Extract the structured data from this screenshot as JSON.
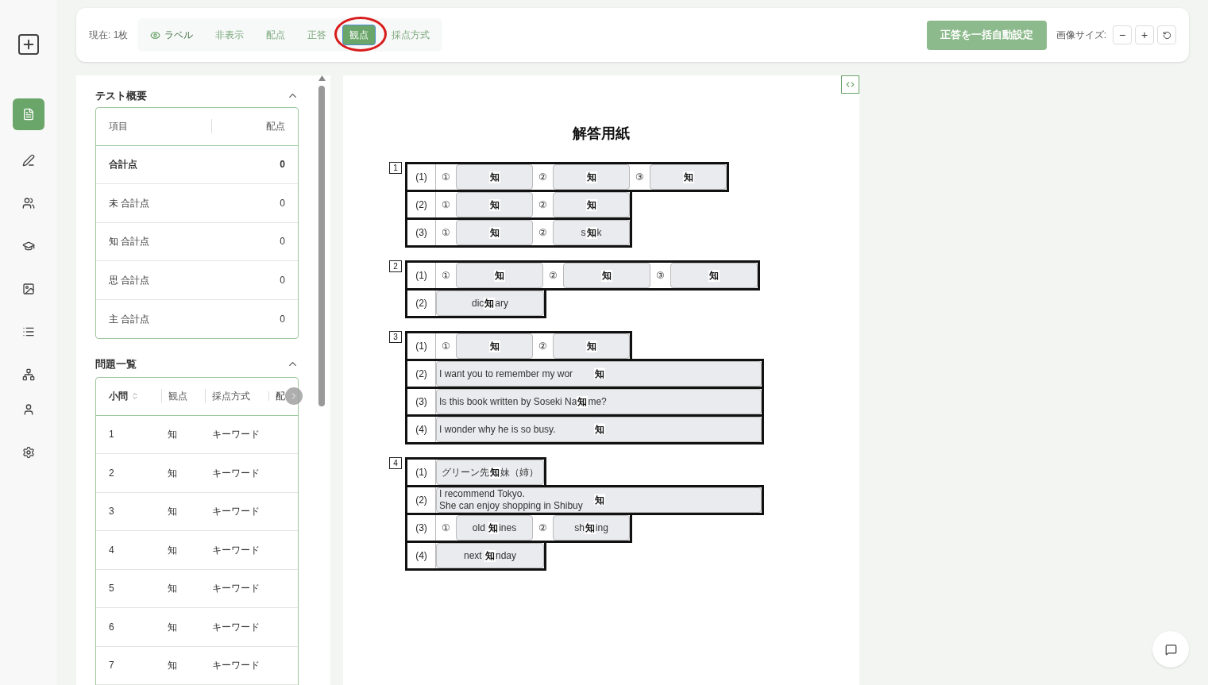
{
  "nav": [
    {
      "selected": false
    },
    {
      "selected": true
    },
    {
      "selected": false
    },
    {
      "selected": false
    },
    {
      "selected": false
    },
    {
      "selected": false
    },
    {
      "selected": false
    },
    {
      "selected": false
    },
    {
      "selected": false
    },
    {
      "selected": false
    }
  ],
  "toolbar": {
    "current": "現在: 1枚",
    "modes": [
      {
        "label": "ラベル",
        "kind": "eye",
        "selected": false
      },
      {
        "label": "非表示",
        "selected": false
      },
      {
        "label": "配点",
        "selected": false
      },
      {
        "label": "正答",
        "selected": false
      },
      {
        "label": "観点",
        "selected": true
      },
      {
        "label": "採点方式",
        "selected": false
      }
    ],
    "auto_button": {
      "label": "正答を一括自動設定",
      "disabled": true
    },
    "image_size_label": "画像サイズ:",
    "size_buttons": [
      {
        "label": "−",
        "kind": "text"
      },
      {
        "label": "+",
        "kind": "text"
      },
      {
        "kind": "reset"
      }
    ]
  },
  "summary": {
    "title": "テスト概要",
    "columns": [
      "項目",
      "配点"
    ],
    "rows": [
      {
        "item": "合計点",
        "score": "0",
        "bold": true
      },
      {
        "item": "未 合計点",
        "score": "0",
        "bold": false
      },
      {
        "item": "知 合計点",
        "score": "0",
        "bold": false
      },
      {
        "item": "思 合計点",
        "score": "0",
        "bold": false
      },
      {
        "item": "主 合計点",
        "score": "0",
        "bold": false
      }
    ]
  },
  "questions": {
    "title": "問題一覧",
    "columns": [
      "小問",
      "観点",
      "採点方式",
      "配"
    ],
    "rows": [
      {
        "no": "1",
        "view": "知",
        "method": "キーワード"
      },
      {
        "no": "2",
        "view": "知",
        "method": "キーワード"
      },
      {
        "no": "3",
        "view": "知",
        "method": "キーワード"
      },
      {
        "no": "4",
        "view": "知",
        "method": "キーワード"
      },
      {
        "no": "5",
        "view": "知",
        "method": "キーワード"
      },
      {
        "no": "6",
        "view": "知",
        "method": "キーワード"
      },
      {
        "no": "7",
        "view": "知",
        "method": "キーワード"
      }
    ]
  },
  "sheet": {
    "title": "解答用紙",
    "sections": [
      {
        "number": "1",
        "rows": [
          {
            "label": "(1)",
            "items": [
              {
                "mark": "①",
                "kind": "short",
                "answer": {
                  "badge": "知",
                  "kind": "centered"
                }
              },
              {
                "mark": "②",
                "kind": "short",
                "answer": {
                  "badge": "知",
                  "kind": "centered"
                }
              },
              {
                "mark": "③",
                "kind": "short",
                "answer": {
                  "badge": "知",
                  "kind": "centered"
                }
              }
            ]
          },
          {
            "label": "(2)",
            "items": [
              {
                "mark": "①",
                "kind": "short",
                "answer": {
                  "badge": "知",
                  "kind": "centered"
                }
              },
              {
                "mark": "②",
                "kind": "short",
                "answer": {
                  "badge": "知",
                  "kind": "centered"
                }
              }
            ]
          },
          {
            "label": "(3)",
            "items": [
              {
                "mark": "①",
                "kind": "short",
                "answer": {
                  "badge": "知",
                  "kind": "centered"
                }
              },
              {
                "mark": "②",
                "kind": "short",
                "answer": {
                  "before": "s",
                  "badge": "知",
                  "after": "k",
                  "kind": "centered"
                }
              }
            ]
          }
        ]
      },
      {
        "number": "2",
        "rows": [
          {
            "label": "(1)",
            "items": [
              {
                "mark": "①",
                "kind": "long",
                "answer": {
                  "badge": "知",
                  "kind": "centered"
                }
              },
              {
                "mark": "②",
                "kind": "long",
                "answer": {
                  "badge": "知",
                  "kind": "centered"
                }
              },
              {
                "mark": "③",
                "kind": "long",
                "answer": {
                  "badge": "知",
                  "kind": "centered"
                }
              }
            ]
          },
          {
            "label": "(2)",
            "items": [
              {
                "kind": "wide",
                "answer": {
                  "before": "dic",
                  "badge": "知",
                  "after": "ary",
                  "kind": "centered"
                }
              }
            ]
          }
        ]
      },
      {
        "number": "3",
        "rows": [
          {
            "label": "(1)",
            "items": [
              {
                "mark": "①",
                "kind": "short",
                "answer": {
                  "badge": "知",
                  "kind": "centered"
                }
              },
              {
                "mark": "②",
                "kind": "short",
                "answer": {
                  "badge": "知",
                  "kind": "centered"
                }
              }
            ]
          },
          {
            "label": "(2)",
            "items": [
              {
                "kind": "full",
                "answer": {
                  "before": "I want you to remember my wor",
                  "badge": "知",
                  "kind": "left"
                }
              }
            ]
          },
          {
            "label": "(3)",
            "items": [
              {
                "kind": "full",
                "answer": {
                  "before": "Is this book written by Soseki Na",
                  "badge": "知",
                  "after": "me?",
                  "kind": "inline"
                }
              }
            ]
          },
          {
            "label": "(4)",
            "items": [
              {
                "kind": "full",
                "answer": {
                  "before": "I wonder why he is so busy.",
                  "badge": "知",
                  "kind": "left"
                }
              }
            ]
          }
        ]
      },
      {
        "number": "4",
        "rows": [
          {
            "label": "(1)",
            "items": [
              {
                "kind": "wide",
                "answer": {
                  "before": "グリーン先",
                  "badge": "知",
                  "after": "妹（姉）",
                  "kind": "centered"
                }
              }
            ]
          },
          {
            "label": "(2)",
            "items": [
              {
                "kind": "full",
                "answer": {
                  "before": "I recommend Tokyo.",
                  "second": "She can enjoy shopping in Shibuy",
                  "badge": "知",
                  "kind": "left"
                }
              }
            ]
          },
          {
            "label": "(3)",
            "items": [
              {
                "mark": "①",
                "kind": "short",
                "answer": {
                  "before": "old ",
                  "badge": "知",
                  "after": "ines",
                  "kind": "centered"
                }
              },
              {
                "mark": "②",
                "kind": "short",
                "answer": {
                  "before": "sh",
                  "badge": "知",
                  "after": "ing",
                  "kind": "centered"
                }
              }
            ]
          },
          {
            "label": "(4)",
            "items": [
              {
                "kind": "wide",
                "answer": {
                  "before": "next ",
                  "badge": "知",
                  "after": "nday",
                  "kind": "centered"
                }
              }
            ]
          }
        ]
      }
    ]
  }
}
